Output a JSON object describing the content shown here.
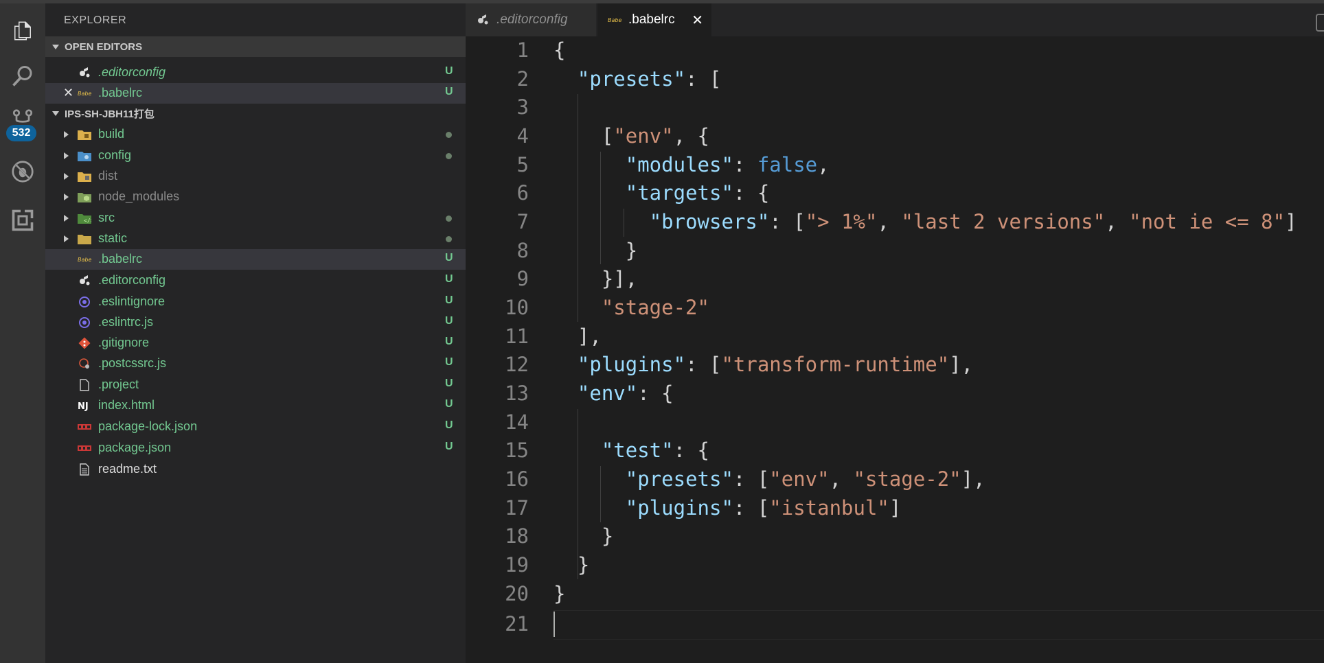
{
  "sidebar": {
    "title": "EXPLORER",
    "open_editors_label": "OPEN EDITORS",
    "open_editors": [
      {
        "name": ".editorconfig",
        "status": "U"
      },
      {
        "name": ".babelrc",
        "status": "U"
      }
    ],
    "project_label": "IPS-SH-JBH11打包",
    "folders": [
      {
        "name": "build"
      },
      {
        "name": "config"
      },
      {
        "name": "dist"
      },
      {
        "name": "node_modules"
      },
      {
        "name": "src"
      },
      {
        "name": "static"
      }
    ],
    "files": [
      {
        "name": ".babelrc",
        "status": "U"
      },
      {
        "name": ".editorconfig",
        "status": "U"
      },
      {
        "name": ".eslintignore",
        "status": "U"
      },
      {
        "name": ".eslintrc.js",
        "status": "U"
      },
      {
        "name": ".gitignore",
        "status": "U"
      },
      {
        "name": ".postcssrc.js",
        "status": "U"
      },
      {
        "name": ".project",
        "status": "U"
      },
      {
        "name": "index.html",
        "status": "U"
      },
      {
        "name": "package-lock.json",
        "status": "U"
      },
      {
        "name": "package.json",
        "status": "U"
      },
      {
        "name": "readme.txt",
        "status": ""
      }
    ]
  },
  "activity": {
    "scm_badge": "532"
  },
  "tabs": [
    {
      "label": ".editorconfig"
    },
    {
      "label": ".babelrc"
    }
  ],
  "editor": {
    "line_numbers": [
      "1",
      "2",
      "3",
      "4",
      "5",
      "6",
      "7",
      "8",
      "9",
      "10",
      "11",
      "12",
      "13",
      "14",
      "15",
      "16",
      "17",
      "18",
      "19",
      "20",
      "21"
    ]
  },
  "colors": {
    "untracked": "#73c991",
    "json_key": "#9cdcfe",
    "json_string": "#ce9178",
    "json_boolean": "#569cd6",
    "scm_badge": "#0e639c"
  }
}
